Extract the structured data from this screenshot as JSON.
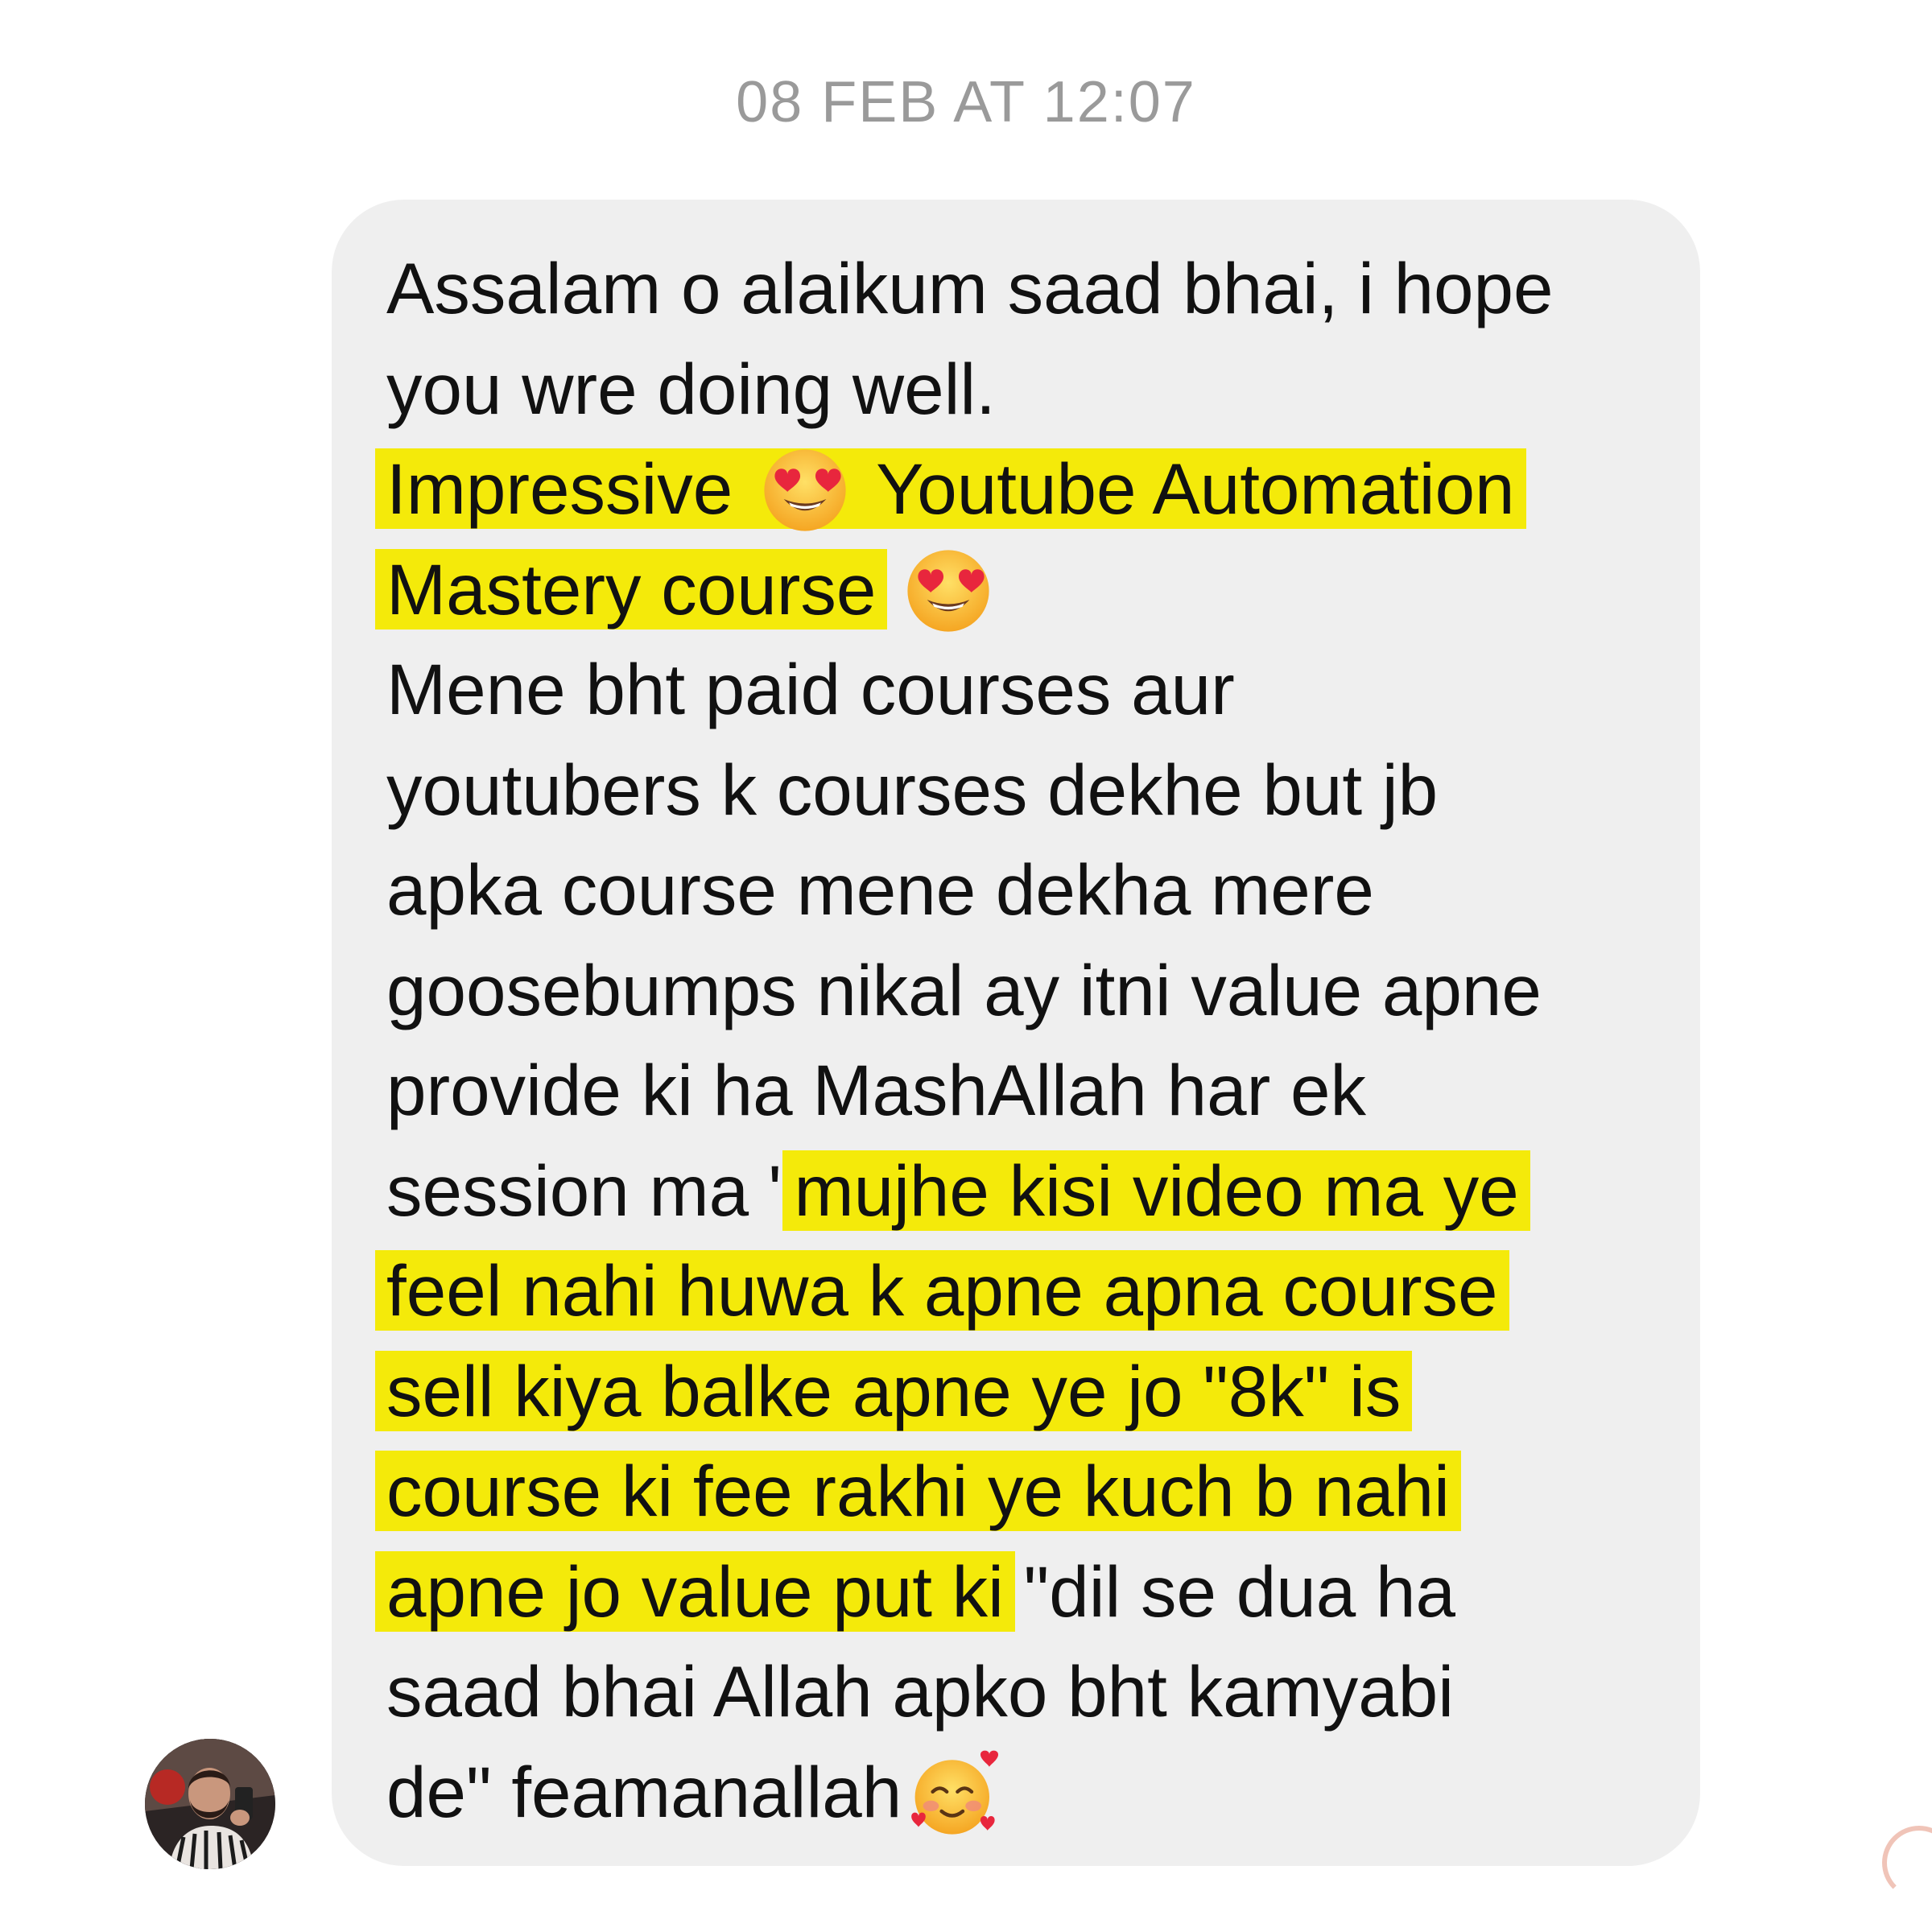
{
  "thread": {
    "timestamp": "08 FEB AT 12:07"
  },
  "message": {
    "lines": [
      {
        "segments": [
          {
            "text": "Assalam o alaikum saad bhai, i hope",
            "hl": false
          }
        ]
      },
      {
        "segments": [
          {
            "text": "you wre doing well.",
            "hl": false
          }
        ]
      },
      {
        "segments": [
          {
            "text": "Impressive ",
            "hl": true
          },
          {
            "emoji": "heart-eyes-emoji",
            "hl": true
          },
          {
            "text": " Youtube Automation",
            "hl": true
          }
        ]
      },
      {
        "segments": [
          {
            "text": "Mastery course",
            "hl": true
          },
          {
            "text": " ",
            "hl": false
          },
          {
            "emoji": "heart-eyes-emoji",
            "hl": false
          }
        ]
      },
      {
        "segments": [
          {
            "text": "Mene bht paid courses aur",
            "hl": false
          }
        ]
      },
      {
        "segments": [
          {
            "text": "youtubers k courses dekhe but jb",
            "hl": false
          }
        ]
      },
      {
        "segments": [
          {
            "text": "apka course mene dekha mere",
            "hl": false
          }
        ]
      },
      {
        "segments": [
          {
            "text": "goosebumps nikal ay itni value apne",
            "hl": false
          }
        ]
      },
      {
        "segments": [
          {
            "text": "provide ki ha MashAllah har ek",
            "hl": false
          }
        ]
      },
      {
        "segments": [
          {
            "text": "session ma \"",
            "hl": false
          },
          {
            "text": "mujhe kisi video ma ye",
            "hl": true
          }
        ]
      },
      {
        "segments": [
          {
            "text": "feel nahi huwa k apne apna course",
            "hl": true
          }
        ]
      },
      {
        "segments": [
          {
            "text": "sell kiya balke apne ye jo \"8k\" is",
            "hl": true
          }
        ]
      },
      {
        "segments": [
          {
            "text": "course ki fee rakhi ye kuch b nahi",
            "hl": true
          }
        ]
      },
      {
        "segments": [
          {
            "text": "apne jo value put ki",
            "hl": true
          },
          {
            "text": " \"dil se dua ha",
            "hl": false
          }
        ]
      },
      {
        "segments": [
          {
            "text": "saad bhai Allah apko bht kamyabi",
            "hl": false
          }
        ]
      },
      {
        "segments": [
          {
            "text": "de\" feamanallah",
            "hl": false
          },
          {
            "emoji": "smiling-face-with-hearts-emoji",
            "hl": false
          }
        ]
      }
    ]
  },
  "colors": {
    "highlight": "#f4ea0a",
    "bubble": "#efefef",
    "timestamp": "#9a9a9a",
    "text": "#111111"
  },
  "icons": [
    "heart-eyes-emoji",
    "smiling-face-with-hearts-emoji",
    "avatar"
  ]
}
